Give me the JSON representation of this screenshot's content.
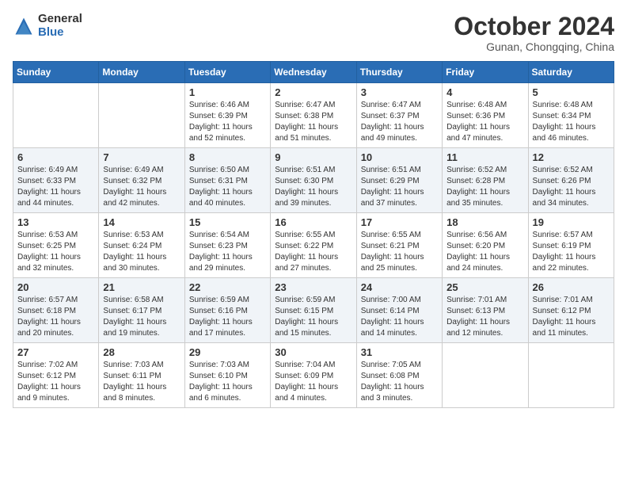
{
  "logo": {
    "general": "General",
    "blue": "Blue"
  },
  "title": "October 2024",
  "location": "Gunan, Chongqing, China",
  "days_header": [
    "Sunday",
    "Monday",
    "Tuesday",
    "Wednesday",
    "Thursday",
    "Friday",
    "Saturday"
  ],
  "weeks": [
    [
      {
        "day": "",
        "content": ""
      },
      {
        "day": "",
        "content": ""
      },
      {
        "day": "1",
        "content": "Sunrise: 6:46 AM\nSunset: 6:39 PM\nDaylight: 11 hours and 52 minutes."
      },
      {
        "day": "2",
        "content": "Sunrise: 6:47 AM\nSunset: 6:38 PM\nDaylight: 11 hours and 51 minutes."
      },
      {
        "day": "3",
        "content": "Sunrise: 6:47 AM\nSunset: 6:37 PM\nDaylight: 11 hours and 49 minutes."
      },
      {
        "day": "4",
        "content": "Sunrise: 6:48 AM\nSunset: 6:36 PM\nDaylight: 11 hours and 47 minutes."
      },
      {
        "day": "5",
        "content": "Sunrise: 6:48 AM\nSunset: 6:34 PM\nDaylight: 11 hours and 46 minutes."
      }
    ],
    [
      {
        "day": "6",
        "content": "Sunrise: 6:49 AM\nSunset: 6:33 PM\nDaylight: 11 hours and 44 minutes."
      },
      {
        "day": "7",
        "content": "Sunrise: 6:49 AM\nSunset: 6:32 PM\nDaylight: 11 hours and 42 minutes."
      },
      {
        "day": "8",
        "content": "Sunrise: 6:50 AM\nSunset: 6:31 PM\nDaylight: 11 hours and 40 minutes."
      },
      {
        "day": "9",
        "content": "Sunrise: 6:51 AM\nSunset: 6:30 PM\nDaylight: 11 hours and 39 minutes."
      },
      {
        "day": "10",
        "content": "Sunrise: 6:51 AM\nSunset: 6:29 PM\nDaylight: 11 hours and 37 minutes."
      },
      {
        "day": "11",
        "content": "Sunrise: 6:52 AM\nSunset: 6:28 PM\nDaylight: 11 hours and 35 minutes."
      },
      {
        "day": "12",
        "content": "Sunrise: 6:52 AM\nSunset: 6:26 PM\nDaylight: 11 hours and 34 minutes."
      }
    ],
    [
      {
        "day": "13",
        "content": "Sunrise: 6:53 AM\nSunset: 6:25 PM\nDaylight: 11 hours and 32 minutes."
      },
      {
        "day": "14",
        "content": "Sunrise: 6:53 AM\nSunset: 6:24 PM\nDaylight: 11 hours and 30 minutes."
      },
      {
        "day": "15",
        "content": "Sunrise: 6:54 AM\nSunset: 6:23 PM\nDaylight: 11 hours and 29 minutes."
      },
      {
        "day": "16",
        "content": "Sunrise: 6:55 AM\nSunset: 6:22 PM\nDaylight: 11 hours and 27 minutes."
      },
      {
        "day": "17",
        "content": "Sunrise: 6:55 AM\nSunset: 6:21 PM\nDaylight: 11 hours and 25 minutes."
      },
      {
        "day": "18",
        "content": "Sunrise: 6:56 AM\nSunset: 6:20 PM\nDaylight: 11 hours and 24 minutes."
      },
      {
        "day": "19",
        "content": "Sunrise: 6:57 AM\nSunset: 6:19 PM\nDaylight: 11 hours and 22 minutes."
      }
    ],
    [
      {
        "day": "20",
        "content": "Sunrise: 6:57 AM\nSunset: 6:18 PM\nDaylight: 11 hours and 20 minutes."
      },
      {
        "day": "21",
        "content": "Sunrise: 6:58 AM\nSunset: 6:17 PM\nDaylight: 11 hours and 19 minutes."
      },
      {
        "day": "22",
        "content": "Sunrise: 6:59 AM\nSunset: 6:16 PM\nDaylight: 11 hours and 17 minutes."
      },
      {
        "day": "23",
        "content": "Sunrise: 6:59 AM\nSunset: 6:15 PM\nDaylight: 11 hours and 15 minutes."
      },
      {
        "day": "24",
        "content": "Sunrise: 7:00 AM\nSunset: 6:14 PM\nDaylight: 11 hours and 14 minutes."
      },
      {
        "day": "25",
        "content": "Sunrise: 7:01 AM\nSunset: 6:13 PM\nDaylight: 11 hours and 12 minutes."
      },
      {
        "day": "26",
        "content": "Sunrise: 7:01 AM\nSunset: 6:12 PM\nDaylight: 11 hours and 11 minutes."
      }
    ],
    [
      {
        "day": "27",
        "content": "Sunrise: 7:02 AM\nSunset: 6:12 PM\nDaylight: 11 hours and 9 minutes."
      },
      {
        "day": "28",
        "content": "Sunrise: 7:03 AM\nSunset: 6:11 PM\nDaylight: 11 hours and 8 minutes."
      },
      {
        "day": "29",
        "content": "Sunrise: 7:03 AM\nSunset: 6:10 PM\nDaylight: 11 hours and 6 minutes."
      },
      {
        "day": "30",
        "content": "Sunrise: 7:04 AM\nSunset: 6:09 PM\nDaylight: 11 hours and 4 minutes."
      },
      {
        "day": "31",
        "content": "Sunrise: 7:05 AM\nSunset: 6:08 PM\nDaylight: 11 hours and 3 minutes."
      },
      {
        "day": "",
        "content": ""
      },
      {
        "day": "",
        "content": ""
      }
    ]
  ]
}
